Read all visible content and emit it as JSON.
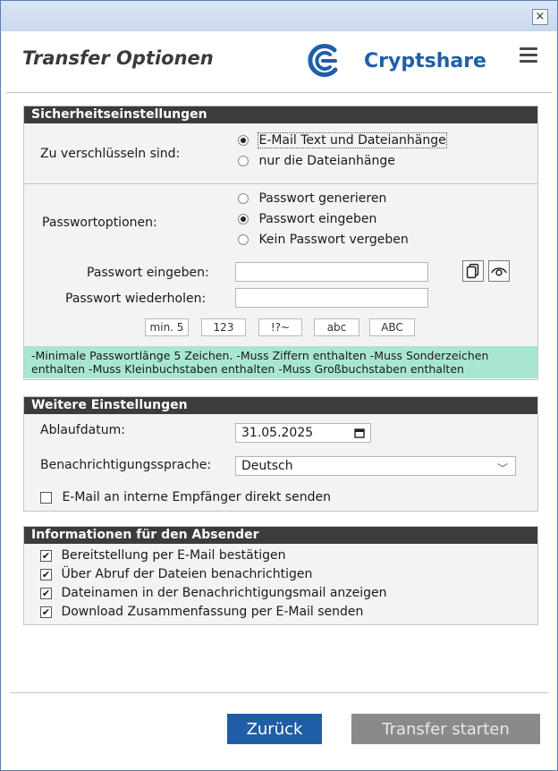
{
  "window": {
    "close_label": "×"
  },
  "header": {
    "title": "Transfer Optionen",
    "brand": "Cryptshare",
    "brand_color": "#1f5fa8"
  },
  "security": {
    "heading": "Sicherheitseinstellungen",
    "encrypt_label": "Zu verschlüsseln sind:",
    "encrypt_options": [
      "E-Mail Text und Dateianhänge",
      "nur die Dateianhänge"
    ],
    "encrypt_selected": "E-Mail Text und Dateianhänge",
    "password_options_label": "Passwortoptionen:",
    "password_options": [
      "Passwort generieren",
      "Passwort eingeben",
      "Kein Passwort vergeben"
    ],
    "password_selected": "Passwort eingeben",
    "password_label": "Passwort eingeben:",
    "password_repeat_label": "Passwort wiederholen:",
    "password_value": "",
    "password_repeat_value": "",
    "rules": [
      "min. 5",
      "123",
      "!?~",
      "abc",
      "ABC"
    ],
    "hint": "-Minimale Passwortlänge 5 Zeichen. -Muss Ziffern enthalten -Muss Sonderzeichen enthalten -Muss Kleinbuchstaben enthalten -Muss Großbuchstaben enthalten",
    "hint_color": "#a9e6cf"
  },
  "further": {
    "heading": "Weitere Einstellungen",
    "expiry_label": "Ablaufdatum:",
    "expiry_value": "31.05.2025",
    "language_label": "Benachrichtigungssprache:",
    "language_value": "Deutsch",
    "direct_send_label": "E-Mail an interne Empfänger direkt senden",
    "direct_send_checked": false
  },
  "sender": {
    "heading": "Informationen für den Absender",
    "options": [
      {
        "label": "Bereitstellung per E-Mail bestätigen",
        "checked": true
      },
      {
        "label": "Über Abruf der Dateien benachrichtigen",
        "checked": true
      },
      {
        "label": "Dateinamen in der Benachrichtigungsmail anzeigen",
        "checked": true
      },
      {
        "label": "Download Zusammenfassung per E-Mail senden",
        "checked": true
      }
    ]
  },
  "footer": {
    "back_label": "Zurück",
    "start_label": "Transfer starten",
    "back_color": "#1f5da6"
  },
  "icons": {
    "copy": "copy-icon",
    "eye": "eye-icon",
    "calendar": "calendar-icon",
    "menu": "menu-icon",
    "chevron": "chevron-down-icon"
  }
}
